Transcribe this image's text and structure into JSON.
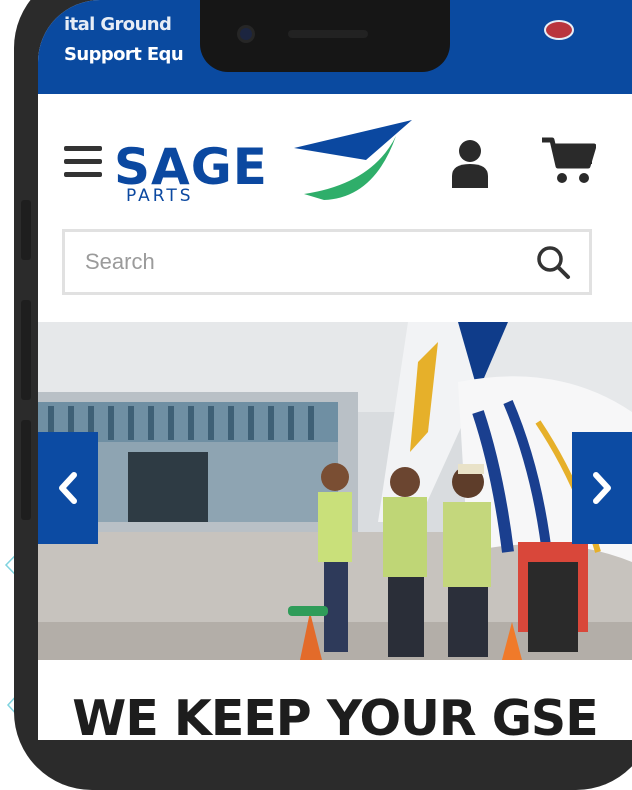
{
  "top_banner": {
    "line1": "ital Ground",
    "line2": "Support Equ"
  },
  "header": {
    "logo_main": "SAGE",
    "logo_sub": "PARTS",
    "icons": [
      "menu-icon",
      "user-icon",
      "cart-icon"
    ]
  },
  "search": {
    "placeholder": "Search",
    "value": ""
  },
  "hero": {
    "prev_icon": "chevron-left-icon",
    "next_icon": "chevron-right-icon"
  },
  "headline": "WE KEEP YOUR GSE",
  "colors": {
    "brand_blue": "#0a4aa0",
    "swoosh_green": "#2fae6a",
    "text_dark": "#1d1d1d"
  }
}
